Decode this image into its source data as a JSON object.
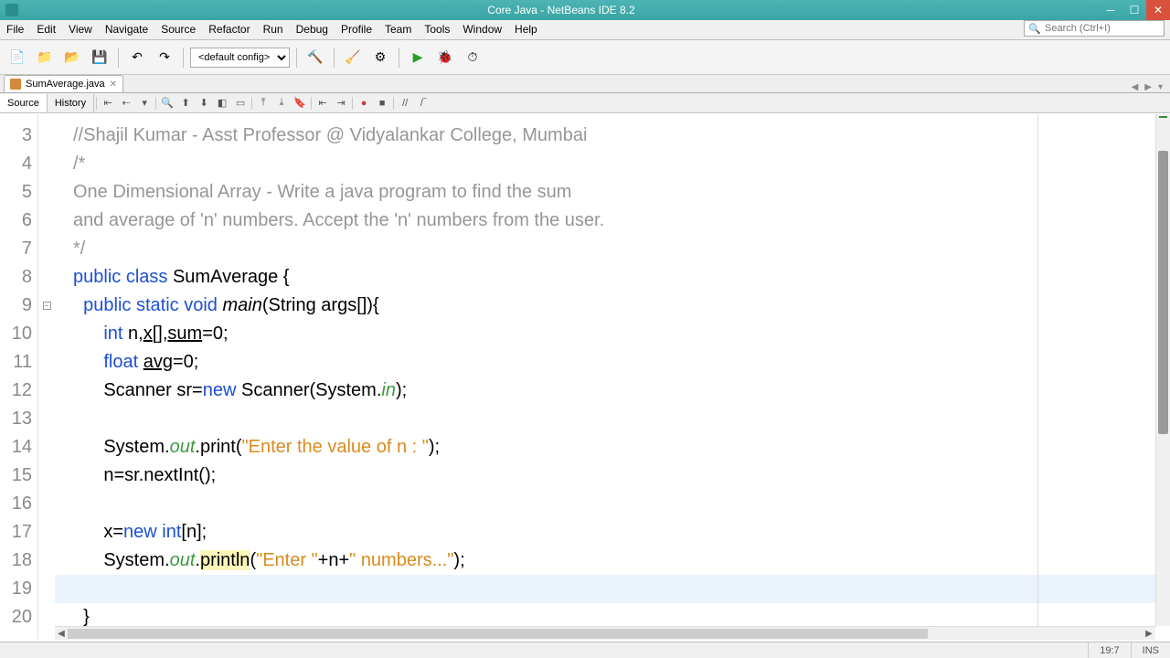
{
  "window": {
    "title": "Core Java - NetBeans IDE 8.2"
  },
  "menu": {
    "items": [
      "File",
      "Edit",
      "View",
      "Navigate",
      "Source",
      "Refactor",
      "Run",
      "Debug",
      "Profile",
      "Team",
      "Tools",
      "Window",
      "Help"
    ],
    "search_placeholder": "Search (Ctrl+I)"
  },
  "toolbar": {
    "config_label": "<default config>"
  },
  "tabs": {
    "file": "SumAverage.java"
  },
  "subtabs": {
    "source": "Source",
    "history": "History"
  },
  "status": {
    "caret": "19:7",
    "mode": "INS"
  },
  "code": {
    "lines": [
      {
        "n": 3,
        "type": "comment",
        "text": "//Shajil Kumar - Asst Professor @ Vidyalankar College, Mumbai"
      },
      {
        "n": 4,
        "type": "comment",
        "text": "/*"
      },
      {
        "n": 5,
        "type": "comment",
        "text": "One Dimensional Array - Write a java program to find the sum"
      },
      {
        "n": 6,
        "type": "comment",
        "text": "and average of 'n' numbers. Accept the 'n' numbers from the user."
      },
      {
        "n": 7,
        "type": "comment",
        "text": "*/"
      },
      {
        "n": 8,
        "type": "classdecl"
      },
      {
        "n": 9,
        "type": "maindecl"
      },
      {
        "n": 10,
        "type": "intdecl"
      },
      {
        "n": 11,
        "type": "floatdecl"
      },
      {
        "n": 12,
        "type": "scanner"
      },
      {
        "n": 13,
        "type": "blank"
      },
      {
        "n": 14,
        "type": "print1"
      },
      {
        "n": 15,
        "type": "nextint"
      },
      {
        "n": 16,
        "type": "blank"
      },
      {
        "n": 17,
        "type": "newarr"
      },
      {
        "n": 18,
        "type": "print2"
      },
      {
        "n": 19,
        "type": "current"
      },
      {
        "n": 20,
        "type": "closebrace"
      }
    ],
    "tokens": {
      "public": "public",
      "class": "class",
      "className": "SumAverage",
      "static": "static",
      "void": "void",
      "main": "main",
      "String": "String",
      "args": "args",
      "int": "int",
      "float": "float",
      "n": "n",
      "x": "x",
      "sum": "sum",
      "avg": "avg",
      "zero": "0",
      "Scanner": "Scanner",
      "sr": "sr",
      "new": "new",
      "System": "System",
      "in": "in",
      "out": "out",
      "print": "print",
      "println": "println",
      "nextInt": "nextInt",
      "str_enter_n": "\"Enter the value of n : \"",
      "str_enter": "\"Enter \"",
      "str_numbers": "\" numbers...\""
    }
  }
}
